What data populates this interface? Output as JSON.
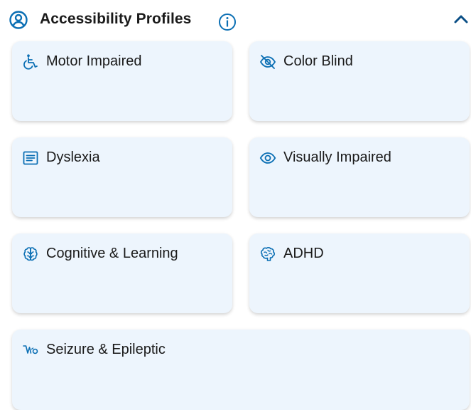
{
  "header": {
    "title": "Accessibility Profiles",
    "header_icon": "user-circle-icon",
    "info_icon": "info-icon",
    "collapse_icon": "chevron-up-icon"
  },
  "accent_color": "#0b6fb4",
  "card_background": "#edf5fd",
  "profiles": [
    {
      "label": "Motor Impaired",
      "icon": "wheelchair-icon"
    },
    {
      "label": "Color Blind",
      "icon": "eye-slash-icon"
    },
    {
      "label": "Dyslexia",
      "icon": "text-lines-icon"
    },
    {
      "label": "Visually Impaired",
      "icon": "eye-icon"
    },
    {
      "label": "Cognitive & Learning",
      "icon": "brain-icon"
    },
    {
      "label": "ADHD",
      "icon": "brain-outline-icon"
    },
    {
      "label": "Seizure & Epileptic",
      "icon": "seizure-icon"
    }
  ]
}
